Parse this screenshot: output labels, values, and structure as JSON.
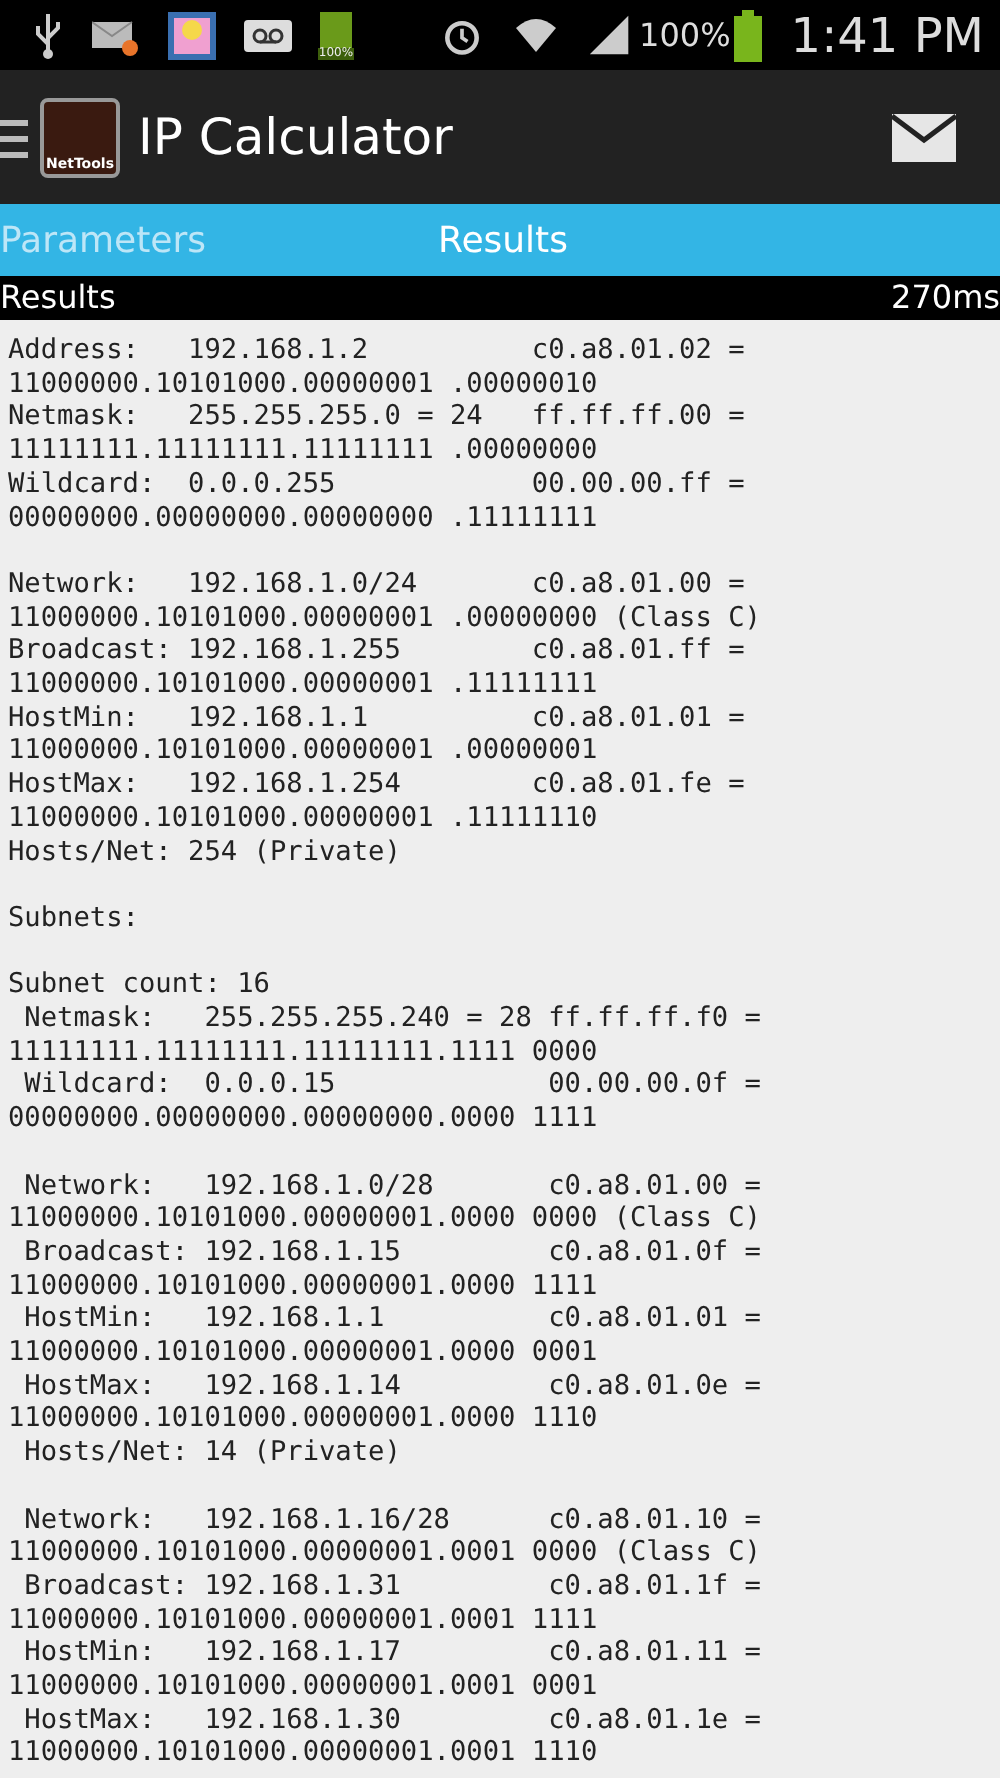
{
  "status_bar": {
    "notification_battery": "100%",
    "battery": "100%",
    "time": "1:41 PM"
  },
  "app_bar": {
    "logo": "NetTools",
    "title": "IP Calculator"
  },
  "tabs": [
    {
      "label": "Parameters",
      "selected": false
    },
    {
      "label": "Results",
      "selected": true
    }
  ],
  "results_header": {
    "title": "Results",
    "elapsed": "270ms"
  },
  "result_blocks": [
    [
      "Address:   192.168.1.2          c0.a8.01.02 =",
      "11000000.10101000.00000001 .00000010",
      "Netmask:   255.255.255.0 = 24   ff.ff.ff.00 =",
      "11111111.11111111.11111111 .00000000",
      "Wildcard:  0.0.0.255            00.00.00.ff =",
      "00000000.00000000.00000000 .11111111"
    ],
    [
      "Network:   192.168.1.0/24       c0.a8.01.00 =",
      "11000000.10101000.00000001 .00000000 (Class C)",
      "Broadcast: 192.168.1.255        c0.a8.01.ff =",
      "11000000.10101000.00000001 .11111111",
      "HostMin:   192.168.1.1          c0.a8.01.01 =",
      "11000000.10101000.00000001 .00000001",
      "HostMax:   192.168.1.254        c0.a8.01.fe =",
      "11000000.10101000.00000001 .11111110",
      "Hosts/Net: 254 (Private)"
    ],
    [
      "Subnets:"
    ],
    [
      "Subnet count: 16",
      " Netmask:   255.255.255.240 = 28 ff.ff.ff.f0 =",
      "11111111.11111111.11111111.1111 0000",
      " Wildcard:  0.0.0.15             00.00.00.0f =",
      "00000000.00000000.00000000.0000 1111"
    ],
    [
      " Network:   192.168.1.0/28       c0.a8.01.00 =",
      "11000000.10101000.00000001.0000 0000 (Class C)",
      " Broadcast: 192.168.1.15         c0.a8.01.0f =",
      "11000000.10101000.00000001.0000 1111",
      " HostMin:   192.168.1.1          c0.a8.01.01 =",
      "11000000.10101000.00000001.0000 0001",
      " HostMax:   192.168.1.14         c0.a8.01.0e =",
      "11000000.10101000.00000001.0000 1110",
      " Hosts/Net: 14 (Private)"
    ],
    [
      " Network:   192.168.1.16/28      c0.a8.01.10 =",
      "11000000.10101000.00000001.0001 0000 (Class C)",
      " Broadcast: 192.168.1.31         c0.a8.01.1f =",
      "11000000.10101000.00000001.0001 1111",
      " HostMin:   192.168.1.17         c0.a8.01.11 =",
      "11000000.10101000.00000001.0001 0001",
      " HostMax:   192.168.1.30         c0.a8.01.1e =",
      "11000000.10101000.00000001.0001 1110"
    ]
  ]
}
